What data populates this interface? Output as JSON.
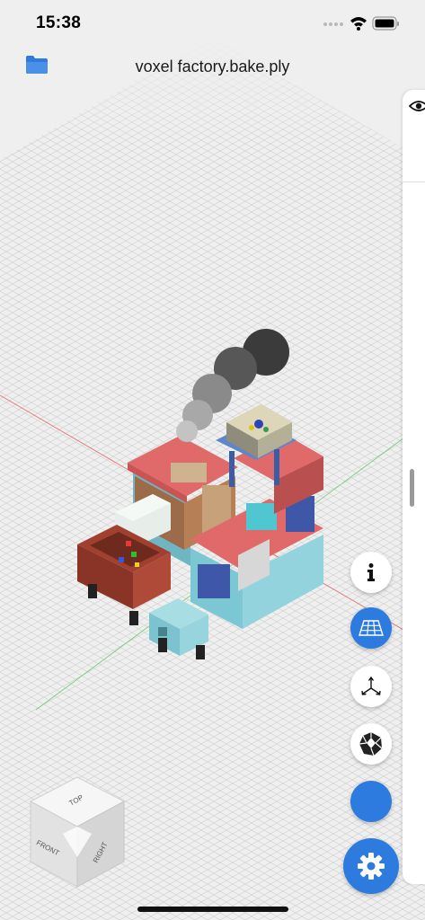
{
  "status_bar": {
    "time": "15:38"
  },
  "header": {
    "file_name": "voxel factory.bake.ply"
  },
  "view_cube": {
    "top": "TOP",
    "front": "FRONT",
    "right": "RIGHT"
  },
  "toolbar": {
    "info_icon": "info-icon",
    "grid_icon": "grid-icon",
    "axes_icon": "axes-icon",
    "mesh_icon": "polyhedron-icon",
    "color_icon": "color-swatch",
    "settings_icon": "gear-icon",
    "grid_active": true
  },
  "side_panel": {
    "visibility_icon": "eye-icon"
  },
  "colors": {
    "accent": "#2e7be0",
    "background": "#efefef",
    "grid": "#d2d2d2",
    "x_axis": "#e05555",
    "y_axis": "#55c055"
  }
}
